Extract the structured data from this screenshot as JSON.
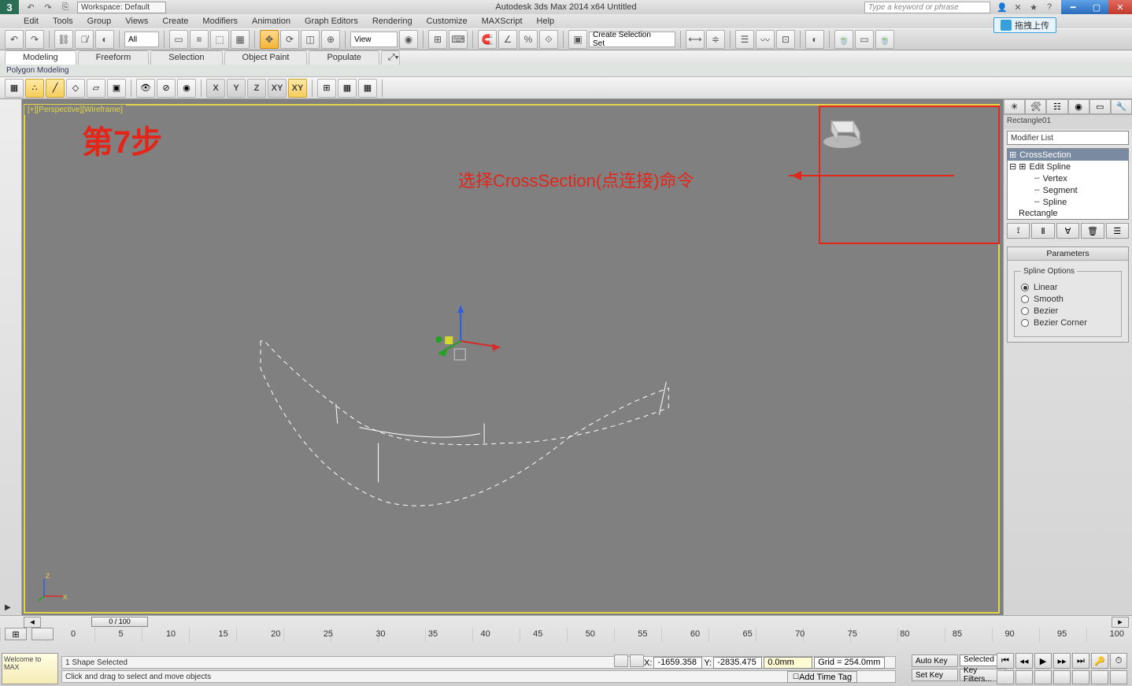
{
  "app": {
    "title": "Autodesk 3ds Max 2014 x64   Untitled",
    "logo": "3"
  },
  "workspace": {
    "label": "Workspace: Default"
  },
  "search": {
    "placeholder": "Type a keyword or phrase"
  },
  "upload_btn": "拖拽上传",
  "menus": [
    "Edit",
    "Tools",
    "Group",
    "Views",
    "Create",
    "Modifiers",
    "Animation",
    "Graph Editors",
    "Rendering",
    "Customize",
    "MAXScript",
    "Help"
  ],
  "toolbar": {
    "all_dd": "All",
    "view_dd": "View",
    "sel_set_dd": "Create Selection Set"
  },
  "ribbon": {
    "tabs": [
      "Modeling",
      "Freeform",
      "Selection",
      "Object Paint",
      "Populate"
    ],
    "group": "Polygon Modeling",
    "axis": [
      "X",
      "Y",
      "Z",
      "XY",
      "XY"
    ]
  },
  "viewport": {
    "label": "[+][Perspective][Wireframe]"
  },
  "annotation": {
    "step": "第7步",
    "text": "选择CrossSection(点连接)命令"
  },
  "panel": {
    "name": "Rectangle01",
    "modifier_dd": "Modifier List",
    "stack": {
      "crosssection": "CrossSection",
      "editspline": "Edit Spline",
      "vertex": "Vertex",
      "segment": "Segment",
      "spline": "Spline",
      "rectangle": "Rectangle"
    },
    "rollout_title": "Parameters",
    "fieldset": "Spline Options",
    "radios": {
      "linear": "Linear",
      "smooth": "Smooth",
      "bezier": "Bezier",
      "bezcorner": "Bezier Corner"
    }
  },
  "timeline": {
    "handle": "0 / 100",
    "ticks": [
      "0",
      "5",
      "10",
      "15",
      "20",
      "25",
      "30",
      "35",
      "40",
      "45",
      "50",
      "55",
      "60",
      "65",
      "70",
      "75",
      "80",
      "85",
      "90",
      "95",
      "100"
    ]
  },
  "status": {
    "sel": "1 Shape Selected",
    "prompt": "Click and drag to select and move objects",
    "x_lbl": "X:",
    "x": "-1659.358",
    "y_lbl": "Y:",
    "y": "-2835.475",
    "z_lbl": "",
    "z": "0.0mm",
    "grid": "Grid = 254.0mm",
    "addtag": "Add Time Tag",
    "welcome": "Welcome to MAX"
  },
  "anim": {
    "autokey": "Auto Key",
    "setkey": "Set Key",
    "selected": "Selected",
    "keyfilters": "Key Filters..."
  }
}
